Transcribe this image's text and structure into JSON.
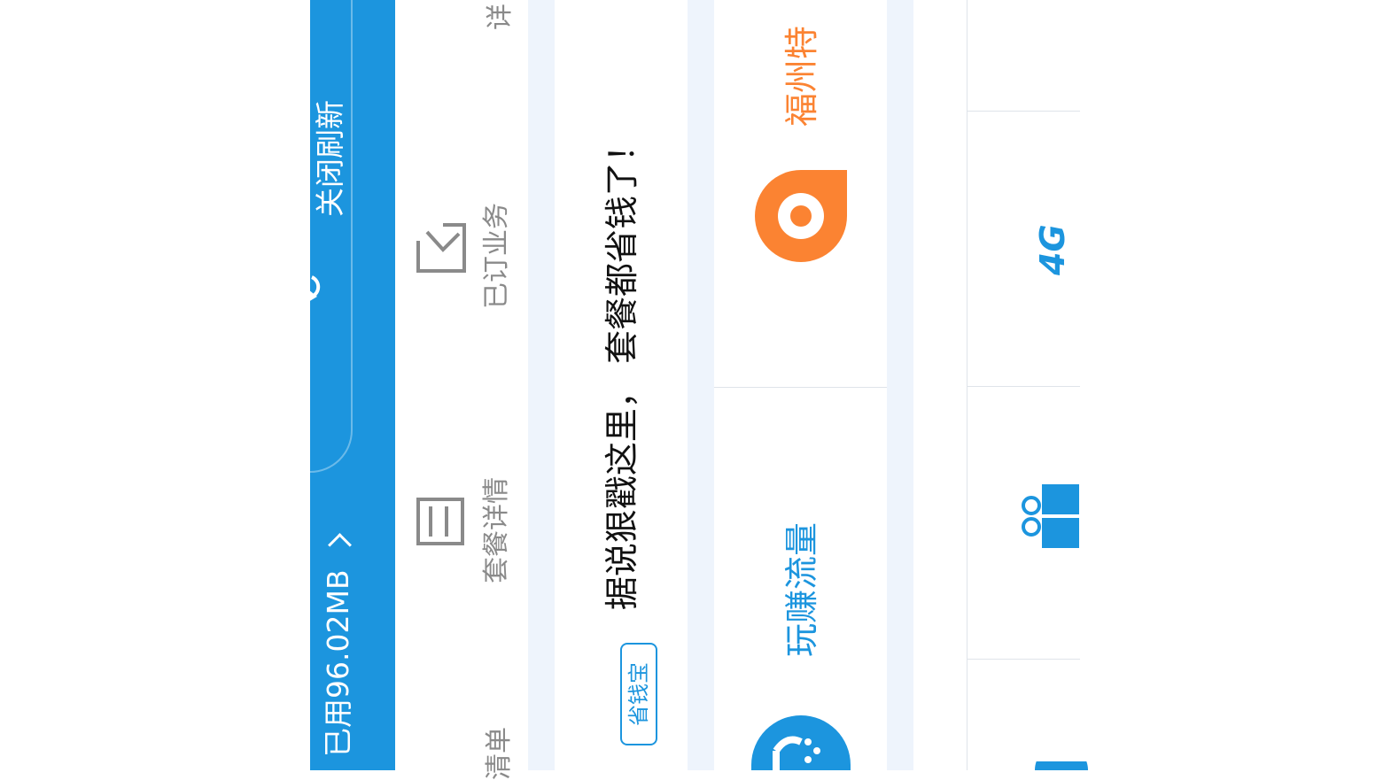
{
  "header": {
    "data_used": "已用96.02MB",
    "close_refresh": "关闭刷新"
  },
  "quick_actions": [
    {
      "label": "套餐详情",
      "icon": "list-icon"
    },
    {
      "label": "已订业务",
      "icon": "check-box-icon"
    },
    {
      "label": "详",
      "icon": "detail-icon"
    },
    {
      "label": "清单",
      "icon": "bill-icon"
    }
  ],
  "promo_banner": {
    "badge": "省钱宝",
    "text": "据说狠戳这里， 套餐都省钱了！"
  },
  "feature_cards": [
    {
      "label": "福州特",
      "icon": "location-pin-icon",
      "color": "#fb8332"
    },
    {
      "label": "玩赚流量",
      "icon": "robot-icon",
      "color": "#1c95de"
    }
  ],
  "bottom_icons": [
    {
      "icon": "4g-icon",
      "text": "4G"
    },
    {
      "icon": "gift-icon"
    },
    {
      "icon": "circle-icon"
    }
  ],
  "colors": {
    "primary_blue": "#1c95de",
    "accent_orange": "#fb8332",
    "text_gray": "#8a8a8a",
    "text_dark": "#111111"
  }
}
